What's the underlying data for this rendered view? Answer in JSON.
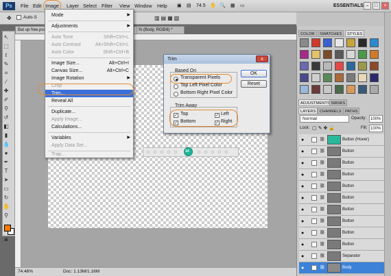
{
  "menubar": {
    "logo": "Ps",
    "items": [
      "File",
      "Edit",
      "Image",
      "Layer",
      "Select",
      "Filter",
      "View",
      "Window",
      "Help"
    ],
    "zoom": "74.5",
    "workspace": "ESSENTIALS"
  },
  "options": {
    "auto_select": "Auto-S"
  },
  "document": {
    "tab_title": "Bat up free.psd @ 74.5% (Body, RGB/8)*",
    "tab2_title": "% (Body, RGB/8) *",
    "status_zoom": "74.46%",
    "status_doc": "Doc: 1.13M/1.16M"
  },
  "image_menu": {
    "items": [
      {
        "label": "Mode",
        "shortcut": "",
        "sub": true,
        "disabled": false
      },
      {
        "label": "Adjustments",
        "shortcut": "",
        "sub": true,
        "disabled": false
      },
      {
        "label": "Auto Tone",
        "shortcut": "Shift+Ctrl+L",
        "disabled": true
      },
      {
        "label": "Auto Contrast",
        "shortcut": "Alt+Shift+Ctrl+L",
        "disabled": true
      },
      {
        "label": "Auto Color",
        "shortcut": "Shift+Ctrl+B",
        "disabled": true
      },
      {
        "label": "Image Size...",
        "shortcut": "Alt+Ctrl+I",
        "disabled": false
      },
      {
        "label": "Canvas Size...",
        "shortcut": "Alt+Ctrl+C",
        "disabled": false
      },
      {
        "label": "Image Rotation",
        "shortcut": "",
        "sub": true,
        "disabled": false
      },
      {
        "label": "Crop",
        "shortcut": "",
        "disabled": true
      },
      {
        "label": "Trim...",
        "shortcut": "",
        "disabled": false,
        "selected": true
      },
      {
        "label": "Reveal All",
        "shortcut": "",
        "disabled": false
      },
      {
        "label": "Duplicate...",
        "shortcut": "",
        "disabled": false
      },
      {
        "label": "Apply Image...",
        "shortcut": "",
        "disabled": true
      },
      {
        "label": "Calculations...",
        "shortcut": "",
        "disabled": false
      },
      {
        "label": "Variables",
        "shortcut": "",
        "sub": true,
        "disabled": false
      },
      {
        "label": "Apply Data Set...",
        "shortcut": "",
        "disabled": true
      },
      {
        "label": "Trap...",
        "shortcut": "",
        "disabled": true
      }
    ]
  },
  "trim_dialog": {
    "title": "Trim",
    "close": "x",
    "based_on_label": "Based On",
    "based_on_options": [
      "Transparent Pixels",
      "Top Left Pixel Color",
      "Bottom Right Pixel Color"
    ],
    "selected_option": "Transparent Pixels",
    "trim_away_label": "Trim Away",
    "trim_top": "Top",
    "trim_bottom": "Bottom",
    "trim_left": "Left",
    "trim_right": "Right",
    "ok": "OK",
    "reset": "Reset"
  },
  "canvas": {
    "knob_label": "14"
  },
  "panels": {
    "top_tabs": [
      "COLOR",
      "SWATCHES",
      "STYLES"
    ],
    "mid_tabs": [
      "ADJUSTMENTS",
      "MASKS"
    ],
    "layer_tabs": [
      "LAYERS",
      "CHANNELS",
      "PATHS"
    ],
    "blend_mode": "Normal",
    "opacity_label": "Opacity:",
    "opacity": "100%",
    "lock_label": "Lock:",
    "fill_label": "Fill:",
    "fill": "100%",
    "style_colors": [
      "#8a8a8a",
      "#cf3a2a",
      "#3a5fcf",
      "#e8e8e8",
      "#c7a33a",
      "#2a2a2a",
      "#2a8acf",
      "#a62a8a",
      "#e2c26a",
      "#7a4a2a",
      "#5a5a5a",
      "#d8d8d8",
      "#4a9a4a",
      "#cf7a2a",
      "#6a6aaf",
      "#3a3a3a",
      "#b8b8b8",
      "#e24a4a",
      "#2a6a9a",
      "#9a9a4a",
      "#8a4a2a",
      "#4a4a8a",
      "#cfcfcf",
      "#5a8a5a",
      "#aa6a3a",
      "#7a7a7a",
      "#e8d8b8",
      "#2a2a6a",
      "#9ab8d8",
      "#6a3a3a",
      "#c8c8c8",
      "#4a6a4a",
      "#d89a5a",
      "#3a5a7a",
      "#aaaaaa"
    ],
    "layers": [
      {
        "name": "Button (Hover)",
        "thumb": "#2ab89a"
      },
      {
        "name": "Button",
        "thumb": "#7a7a7a"
      },
      {
        "name": "Button",
        "thumb": "#7a7a7a"
      },
      {
        "name": "Button",
        "thumb": "#7a7a7a"
      },
      {
        "name": "Button",
        "thumb": "#7a7a7a"
      },
      {
        "name": "Button",
        "thumb": "#7a7a7a"
      },
      {
        "name": "Button",
        "thumb": "#7a7a7a"
      },
      {
        "name": "Button",
        "thumb": "#7a7a7a"
      },
      {
        "name": "Button",
        "thumb": "#7a7a7a"
      },
      {
        "name": "Button",
        "thumb": "#7a7a7a"
      },
      {
        "name": "Separator",
        "thumb": "#7a7a7a"
      },
      {
        "name": "Body",
        "thumb": "#8a8a8a",
        "selected": true
      }
    ]
  }
}
